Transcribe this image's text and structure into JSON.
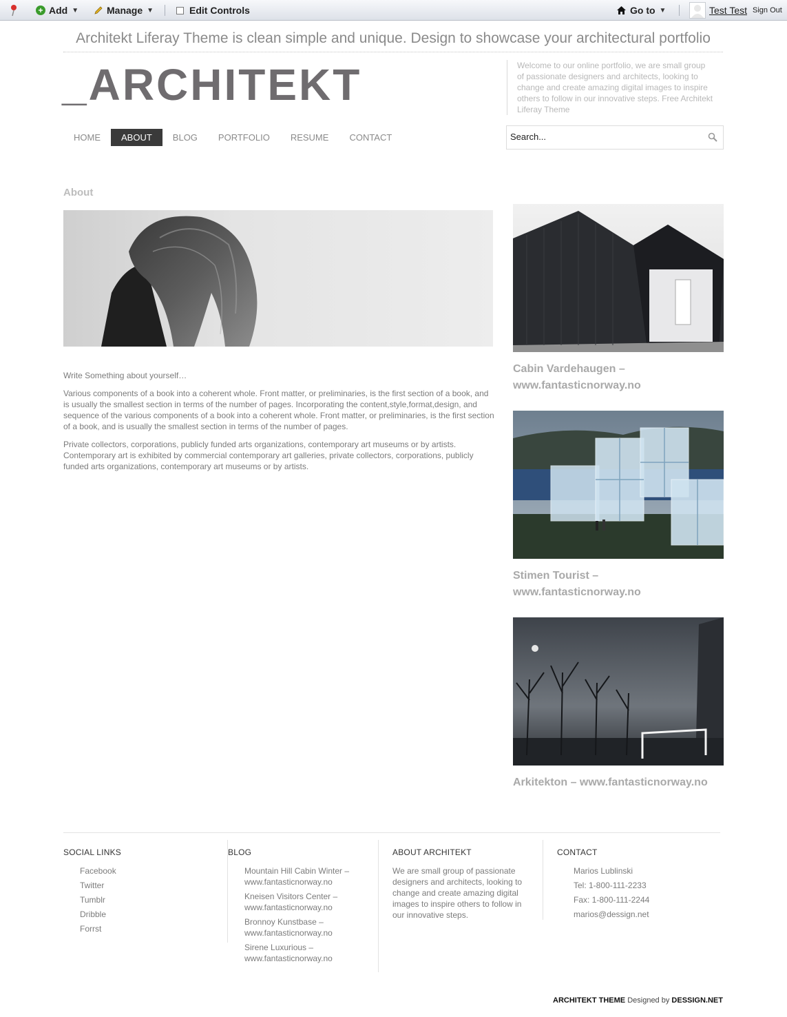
{
  "dockbar": {
    "add": "Add",
    "manage": "Manage",
    "edit_controls": "Edit Controls",
    "goto": "Go to",
    "user": "Test Test",
    "signout": "Sign Out"
  },
  "header": {
    "tagline": "Architekt Liferay Theme is clean simple and unique. Design to showcase your architectural portfolio",
    "logo": "_ARCHITEKT",
    "welcome": "Welcome to our online portfolio, we are small group of passionate designers and architects, looking to change and create amazing digital images to inspire others to follow in our innovative steps. Free Architekt Liferay Theme"
  },
  "nav": {
    "items": [
      "HOME",
      "ABOUT",
      "BLOG",
      "PORTFOLIO",
      "RESUME",
      "CONTACT"
    ],
    "active": "ABOUT"
  },
  "search": {
    "placeholder": "Search..."
  },
  "main": {
    "title": "About",
    "paragraphs": [
      "Write Something about yourself…",
      "Various components of a book into a coherent whole. Front matter, or preliminaries, is the first section of a book, and is usually the smallest section in terms of the number of pages. Incorporating the content,style,format,design, and sequence of the various components of a book into a coherent whole. Front matter, or preliminaries, is the first section of a book, and is usually the smallest section in terms of the number of pages.",
      "Private collectors, corporations, publicly funded arts organizations, contemporary art museums or by artists. Contemporary art is exhibited by commercial contemporary art galleries, private collectors, corporations, publicly funded arts organizations, contemporary art museums or by artists."
    ]
  },
  "projects": [
    {
      "caption": "Cabin Vardehaugen – www.fantasticnorway.no"
    },
    {
      "caption": "Stimen Tourist – www.fantasticnorway.no"
    },
    {
      "caption": "Arkitekton – www.fantasticnorway.no"
    }
  ],
  "footer": {
    "social": {
      "title": "SOCIAL LINKS",
      "items": [
        "Facebook",
        "Twitter",
        "Tumblr",
        "Dribble",
        "Forrst"
      ]
    },
    "blog": {
      "title": "BLOG",
      "items": [
        "Mountain Hill Cabin Winter – www.fantasticnorway.no",
        "Kneisen Visitors Center – www.fantasticnorway.no",
        "Bronnoy Kunstbase – www.fantasticnorway.no",
        "Sirene Luxurious – www.fantasticnorway.no"
      ]
    },
    "about": {
      "title": "ABOUT ARCHITEKT",
      "text": "We are small group of passionate designers and architects, looking to change and create amazing digital images to inspire others to follow in our innovative steps."
    },
    "contact": {
      "title": "CONTACT",
      "items": [
        "Marios Lublinski",
        "Tel: 1-800-111-2233",
        "Fax: 1-800-111-2244",
        "marios@dessign.net"
      ]
    },
    "credit": {
      "theme": "ARCHITEKT THEME",
      "designed_by": "Designed by",
      "brand": "DESSIGN.NET"
    }
  },
  "colors": {
    "accent_dark": "#3a3a3a",
    "text": "#7b7b7b",
    "caption": "#a9a9a9"
  }
}
